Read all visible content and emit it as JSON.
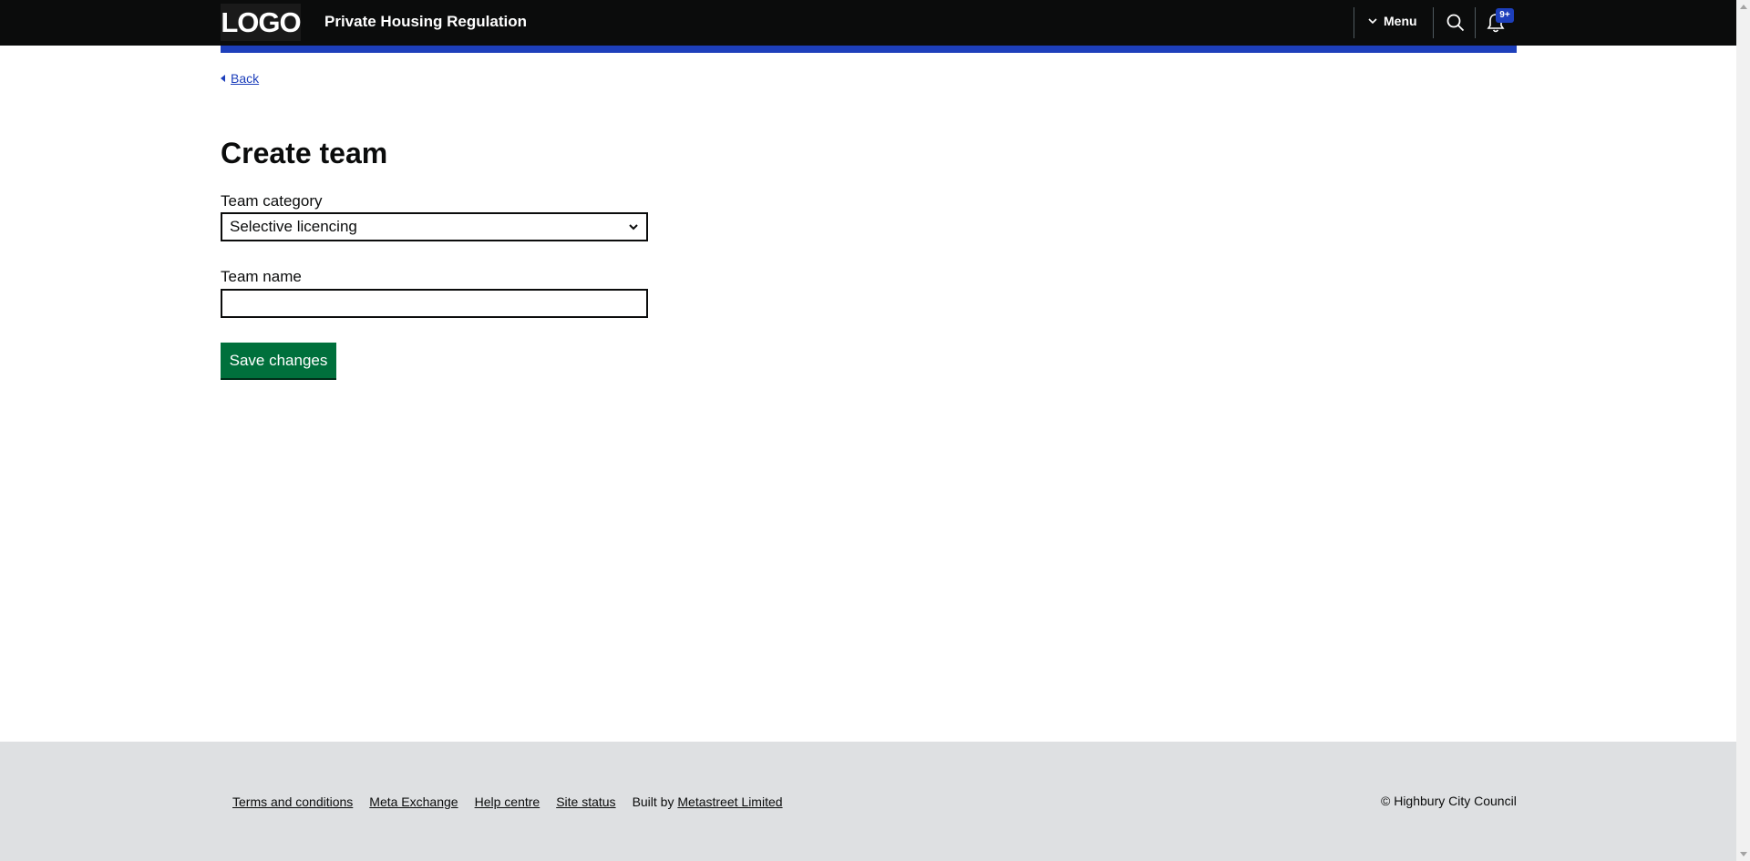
{
  "header": {
    "logo_text": "LOGO",
    "service_name": "Private Housing Regulation",
    "menu_label": "Menu",
    "notifications_badge": "9+"
  },
  "main": {
    "back_label": "Back",
    "title": "Create team",
    "team_category": {
      "label": "Team category",
      "selected_value": "Selective licencing"
    },
    "team_name": {
      "label": "Team name",
      "value": ""
    },
    "save_label": "Save changes"
  },
  "footer": {
    "links": [
      "Terms and conditions",
      "Meta Exchange",
      "Help centre",
      "Site status"
    ],
    "built_by_prefix": "Built by",
    "built_by_link": "Metastreet Limited",
    "copyright": "© Highbury City Council"
  },
  "colors": {
    "header_bg": "#0b0c0c",
    "accent_blue": "#1d3fbb",
    "button_green": "#00703c",
    "footer_bg": "#dee0e2"
  },
  "icons": [
    "chevron-down-icon",
    "search-icon",
    "bell-icon",
    "back-triangle-icon"
  ]
}
